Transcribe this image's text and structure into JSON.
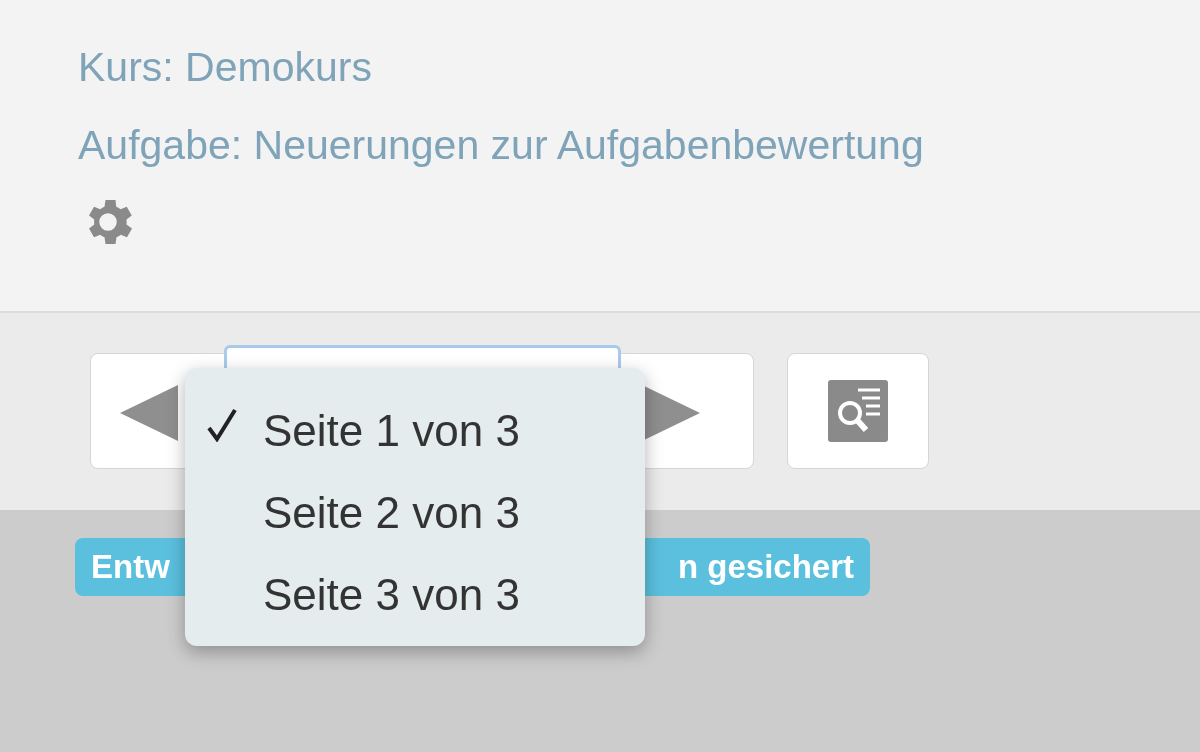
{
  "breadcrumbs": [
    {
      "text": "Kurs: Demokurs"
    },
    {
      "text": "Aufgabe: Neuerungen zur Aufgabenbewertung"
    }
  ],
  "page_menu": {
    "items": [
      {
        "label": "Seite 1 von 3",
        "selected": true
      },
      {
        "label": "Seite 2 von 3",
        "selected": false
      },
      {
        "label": "Seite 3 von 3",
        "selected": false
      }
    ]
  },
  "status_badge": {
    "text_left": "Entw",
    "text_right": "n gesichert"
  }
}
